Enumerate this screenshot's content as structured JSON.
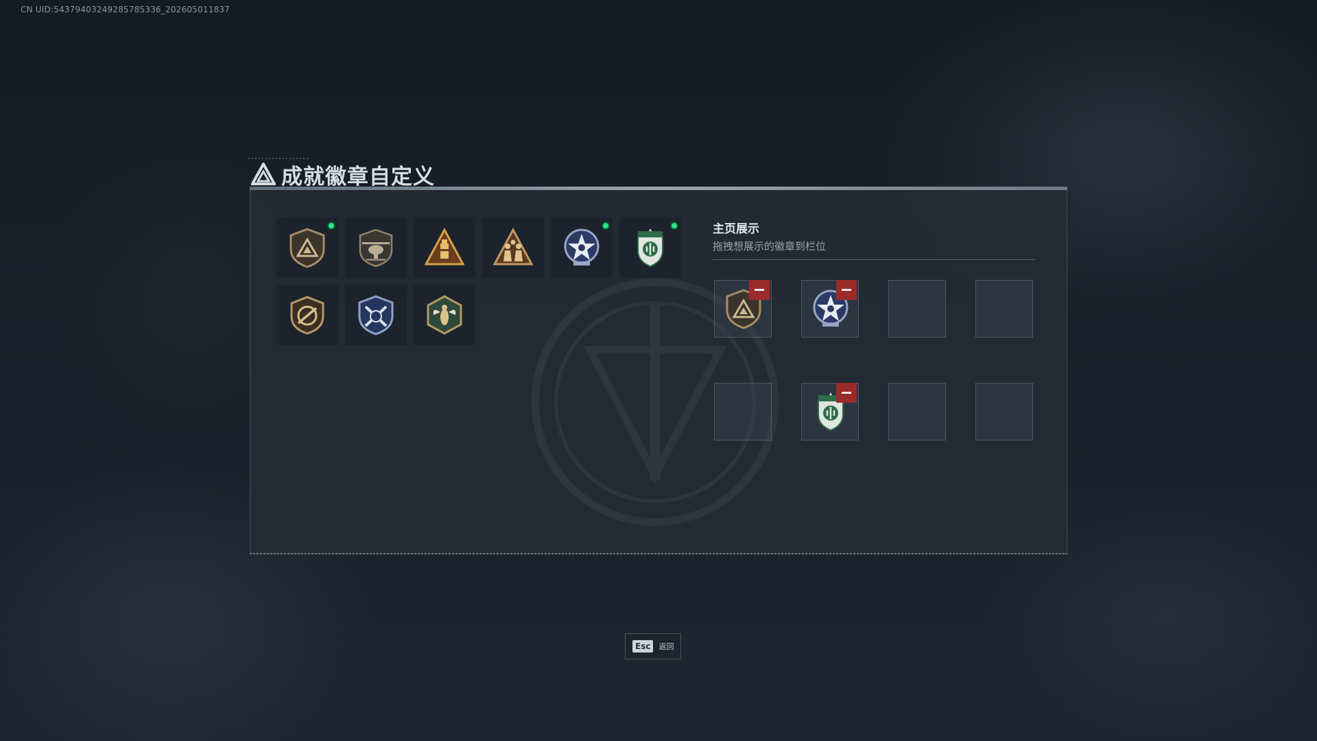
{
  "uid_text": "CN UID:5437940324928578533​6_202605011837",
  "title": "成就徽章自定义",
  "showcase": {
    "title": "主页展示",
    "subtitle": "拖拽想展示的徽章到栏位"
  },
  "badges": [
    {
      "icon": "bronze-triangle-shield-badge",
      "equipped": true
    },
    {
      "icon": "helicopter-badge",
      "equipped": false
    },
    {
      "icon": "gold-triangle-ammo-badge",
      "equipped": false
    },
    {
      "icon": "soldiers-triangle-badge",
      "equipped": false
    },
    {
      "icon": "blue-star-wreath-badge",
      "equipped": true
    },
    {
      "icon": "green-shield-badge",
      "equipped": true
    },
    {
      "icon": "rifle-shield-badge",
      "equipped": false
    },
    {
      "icon": "blue-crossed-shield-badge",
      "equipped": false
    },
    {
      "icon": "wasp-hexagon-badge",
      "equipped": false
    }
  ],
  "slots": [
    {
      "filled": true,
      "icon": "bronze-triangle-shield-badge"
    },
    {
      "filled": true,
      "icon": "blue-star-wreath-badge"
    },
    {
      "filled": false
    },
    {
      "filled": false
    },
    {
      "filled": false
    },
    {
      "filled": true,
      "icon": "green-shield-badge"
    },
    {
      "filled": false
    },
    {
      "filled": false
    }
  ],
  "footer": {
    "key": "Esc",
    "label": "返回"
  },
  "colors": {
    "equipped_dot": "#2ee585",
    "remove_button": "#9b2a2a"
  }
}
